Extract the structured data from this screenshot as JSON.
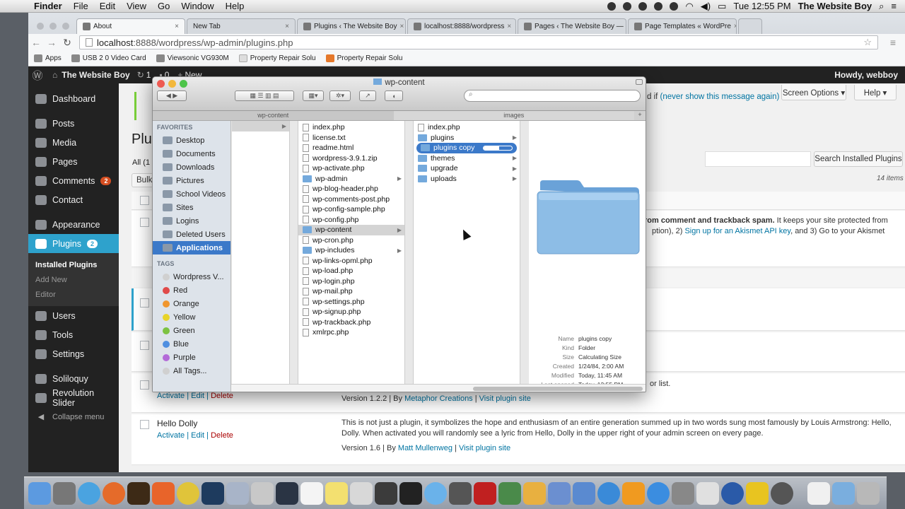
{
  "menubar": {
    "app": "Finder",
    "items": [
      "File",
      "Edit",
      "View",
      "Go",
      "Window",
      "Help"
    ],
    "clock": "Tue 12:55 PM",
    "user": "The Website Boy"
  },
  "browser": {
    "tabs": [
      {
        "label": "About"
      },
      {
        "label": "New Tab"
      },
      {
        "label": "Plugins ‹ The Website Boy"
      },
      {
        "label": "localhost:8888/wordpress"
      },
      {
        "label": "Pages ‹ The Website Boy —"
      },
      {
        "label": "Page Templates « WordPre"
      }
    ],
    "url_host": "localhost",
    "url_rest": ":8888/wordpress/wp-admin/plugins.php",
    "bookmarks": [
      "Apps",
      "USB 2 0 Video Card",
      "Viewsonic VG930M",
      "Property Repair Solu",
      "Property Repair Solu"
    ]
  },
  "adminbar": {
    "site": "The Website Boy",
    "comments": "1",
    "updates": "0",
    "new": "New",
    "howdy": "Howdy, webboy"
  },
  "sidebar": {
    "items": [
      {
        "label": "Dashboard"
      },
      {
        "label": "Posts"
      },
      {
        "label": "Media"
      },
      {
        "label": "Pages"
      },
      {
        "label": "Comments",
        "badge": "2"
      },
      {
        "label": "Contact"
      },
      {
        "label": "Appearance"
      },
      {
        "label": "Plugins",
        "badge": "2"
      }
    ],
    "plugins_sub": [
      "Installed Plugins",
      "Add New",
      "Editor"
    ],
    "items2": [
      {
        "label": "Users"
      },
      {
        "label": "Tools"
      },
      {
        "label": "Settings"
      },
      {
        "label": "Soliloquy"
      },
      {
        "label": "Revolution Slider"
      }
    ],
    "collapse": "Collapse menu"
  },
  "wp": {
    "notice_tail": "d if",
    "notice_link": "(never show this message again)",
    "notice_x": "X",
    "screen_options": "Screen Options ▾",
    "help": "Help ▾",
    "title_frag": "Plu",
    "all_frag": "All (1",
    "bulk_frag": "Bulk",
    "search_btn": "Search Installed Plugins",
    "items_count": "14 items",
    "akismet_bold": "rom comment and trackback spam.",
    "akismet_rest": " It keeps your site protected from",
    "akismet_line2a": "ption), 2) ",
    "akismet_link": "Sign up for an Akismet API key",
    "akismet_line2b": ", and 3) Go to your Akismet",
    "orlist": "or list.",
    "row1": {
      "actions": [
        "Activate",
        "Edit",
        "Delete"
      ],
      "version": "Version 1.2.2 | By ",
      "author": "Metaphor Creations",
      "visit": "Visit plugin site"
    },
    "hello": {
      "name": "Hello Dolly",
      "actions": [
        "Activate",
        "Edit",
        "Delete"
      ],
      "desc1": "This is not just a plugin, it symbolizes the hope and enthusiasm of an entire generation summed up in two words sung most famously by Louis Armstrong: Hello,",
      "desc2": "Dolly. When activated you will randomly see a lyric from Hello, Dolly in the upper right of your admin screen on every page.",
      "version": "Version 1.6 | By ",
      "author": "Matt Mullenweg",
      "visit": "Visit plugin site"
    }
  },
  "finder": {
    "title": "wp-content",
    "tabs": [
      "wp-content",
      "images"
    ],
    "favorites_header": "FAVORITES",
    "favorites": [
      "Desktop",
      "Documents",
      "Downloads",
      "Pictures",
      "School Videos",
      "Sites",
      "Logins",
      "Deleted Users",
      "Applications"
    ],
    "tags_header": "TAGS",
    "tags": [
      {
        "label": "Wordpress V...",
        "color": "#d0d0d0"
      },
      {
        "label": "Red",
        "color": "#e04a4a"
      },
      {
        "label": "Orange",
        "color": "#f0962e"
      },
      {
        "label": "Yellow",
        "color": "#e8d42a"
      },
      {
        "label": "Green",
        "color": "#7cc241"
      },
      {
        "label": "Blue",
        "color": "#4f8fe0"
      },
      {
        "label": "Purple",
        "color": "#b36ad8"
      },
      {
        "label": "All Tags...",
        "color": "#d0d0d0"
      }
    ],
    "col2": [
      {
        "n": "index.php",
        "f": false
      },
      {
        "n": "license.txt",
        "f": false
      },
      {
        "n": "readme.html",
        "f": false
      },
      {
        "n": "wordpress-3.9.1.zip",
        "f": false
      },
      {
        "n": "wp-activate.php",
        "f": false
      },
      {
        "n": "wp-admin",
        "f": true
      },
      {
        "n": "wp-blog-header.php",
        "f": false
      },
      {
        "n": "wp-comments-post.php",
        "f": false
      },
      {
        "n": "wp-config-sample.php",
        "f": false
      },
      {
        "n": "wp-config.php",
        "f": false
      },
      {
        "n": "wp-content",
        "f": true,
        "sel": true
      },
      {
        "n": "wp-cron.php",
        "f": false
      },
      {
        "n": "wp-includes",
        "f": true
      },
      {
        "n": "wp-links-opml.php",
        "f": false
      },
      {
        "n": "wp-load.php",
        "f": false
      },
      {
        "n": "wp-login.php",
        "f": false
      },
      {
        "n": "wp-mail.php",
        "f": false
      },
      {
        "n": "wp-settings.php",
        "f": false
      },
      {
        "n": "wp-signup.php",
        "f": false
      },
      {
        "n": "wp-trackback.php",
        "f": false
      },
      {
        "n": "xmlrpc.php",
        "f": false
      }
    ],
    "col3": [
      {
        "n": "index.php",
        "f": false
      },
      {
        "n": "plugins",
        "f": true
      },
      {
        "n": "plugins copy",
        "f": true,
        "copying": true
      },
      {
        "n": "themes",
        "f": true
      },
      {
        "n": "upgrade",
        "f": true
      },
      {
        "n": "uploads",
        "f": true
      }
    ],
    "copy_progress": 0.55,
    "info": [
      [
        "Name",
        "plugins copy"
      ],
      [
        "Kind",
        "Folder"
      ],
      [
        "Size",
        "Calculating Size"
      ],
      [
        "Created",
        "1/24/84, 2:00 AM"
      ],
      [
        "Modified",
        "Today, 11:45 AM"
      ],
      [
        "Last opened",
        "Today, 12:55 PM"
      ]
    ]
  }
}
